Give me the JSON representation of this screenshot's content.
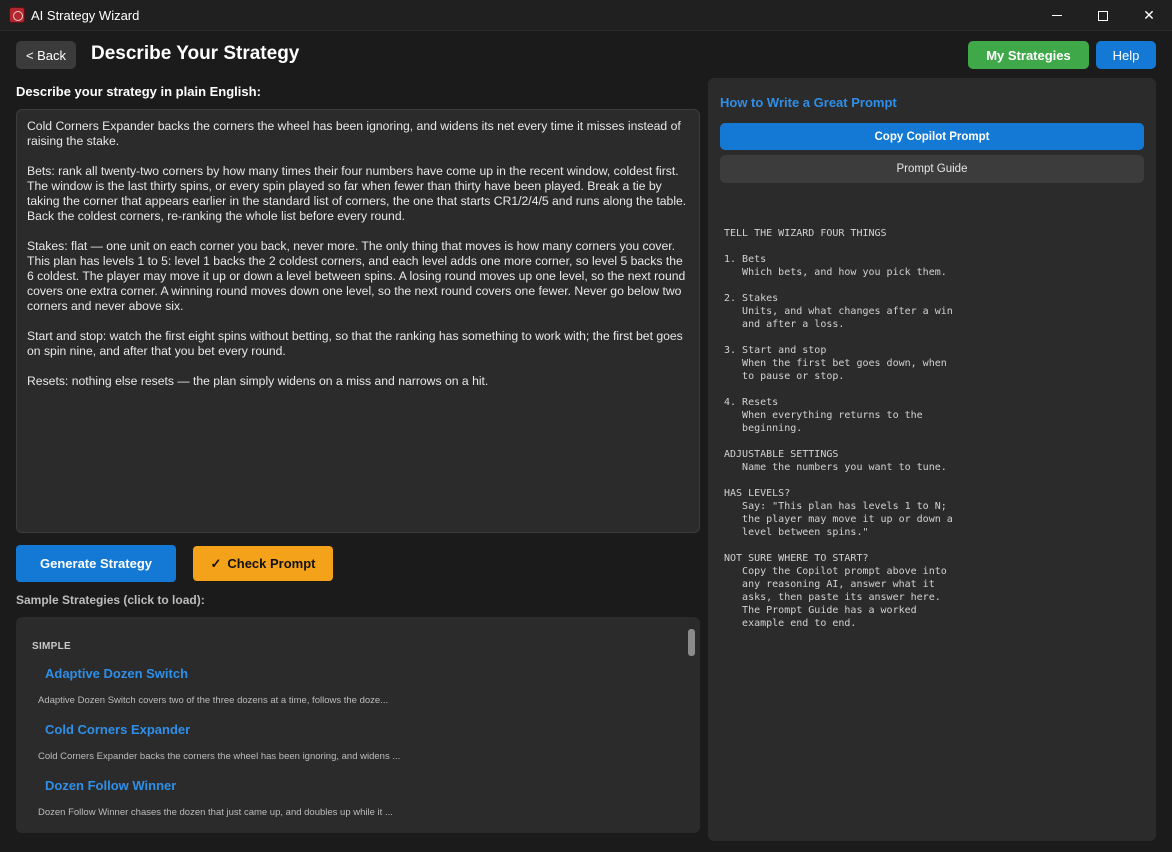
{
  "window": {
    "title": "AI Strategy Wizard",
    "controls": {
      "minimize": "",
      "maximize": "",
      "close": "✕"
    }
  },
  "header": {
    "back_label": "< Back",
    "title": "Describe Your Strategy",
    "my_strategies_label": "My Strategies",
    "help_label": "Help"
  },
  "editor": {
    "label": "Describe your strategy in plain English:",
    "paragraphs": [
      "Cold Corners Expander backs the corners the wheel has been ignoring, and widens its net every time it misses instead of raising the stake.",
      "Bets: rank all twenty-two corners by how many times their four numbers have come up in the recent window, coldest first. The window is the last thirty spins, or every spin played so far when fewer than thirty have been played. Break a tie by taking the corner that appears earlier in the standard list of corners, the one that starts CR1/2/4/5 and runs along the table. Back the coldest corners, re-ranking the whole list before every round.",
      "Stakes: flat — one unit on each corner you back, never more. The only thing that moves is how many corners you cover. This plan has levels 1 to 5: level 1 backs the 2 coldest corners, and each level adds one more corner, so level 5 backs the 6 coldest. The player may move it up or down a level between spins. A losing round moves up one level, so the next round covers one extra corner. A winning round moves down one level, so the next round covers one fewer. Never go below two corners and never above six.",
      "Start and stop: watch the first eight spins without betting, so that the ranking has something to work with; the first bet goes on spin nine, and after that you bet every round.",
      "Resets: nothing else resets — the plan simply widens on a miss and narrows on a hit."
    ]
  },
  "actions": {
    "generate_label": "Generate Strategy",
    "check_icon": "✓",
    "check_label": "Check Prompt"
  },
  "samples": {
    "label": "Sample Strategies (click to load):",
    "section": "SIMPLE",
    "items": [
      {
        "title": "Adaptive Dozen Switch",
        "desc": "Adaptive Dozen Switch covers two of the three dozens at a time, follows the doze..."
      },
      {
        "title": "Cold Corners Expander",
        "desc": "Cold Corners Expander backs the corners the wheel has been ignoring, and widens ..."
      },
      {
        "title": "Dozen Follow Winner",
        "desc": "Dozen Follow Winner chases the dozen that just came up, and doubles up while it ..."
      }
    ]
  },
  "guide": {
    "title": "How to Write a Great Prompt",
    "copy_label": "Copy Copilot Prompt",
    "guide_label": "Prompt Guide",
    "text": "TELL THE WIZARD FOUR THINGS\n\n1. Bets\n   Which bets, and how you pick them.\n\n2. Stakes\n   Units, and what changes after a win\n   and after a loss.\n\n3. Start and stop\n   When the first bet goes down, when\n   to pause or stop.\n\n4. Resets\n   When everything returns to the\n   beginning.\n\nADJUSTABLE SETTINGS\n   Name the numbers you want to tune.\n\nHAS LEVELS?\n   Say: \"This plan has levels 1 to N;\n   the player may move it up or down a\n   level between spins.\"\n\nNOT SURE WHERE TO START?\n   Copy the Copilot prompt above into\n   any reasoning AI, answer what it\n   asks, then paste its answer here.\n   The Prompt Guide has a worked\n   example end to end."
  }
}
